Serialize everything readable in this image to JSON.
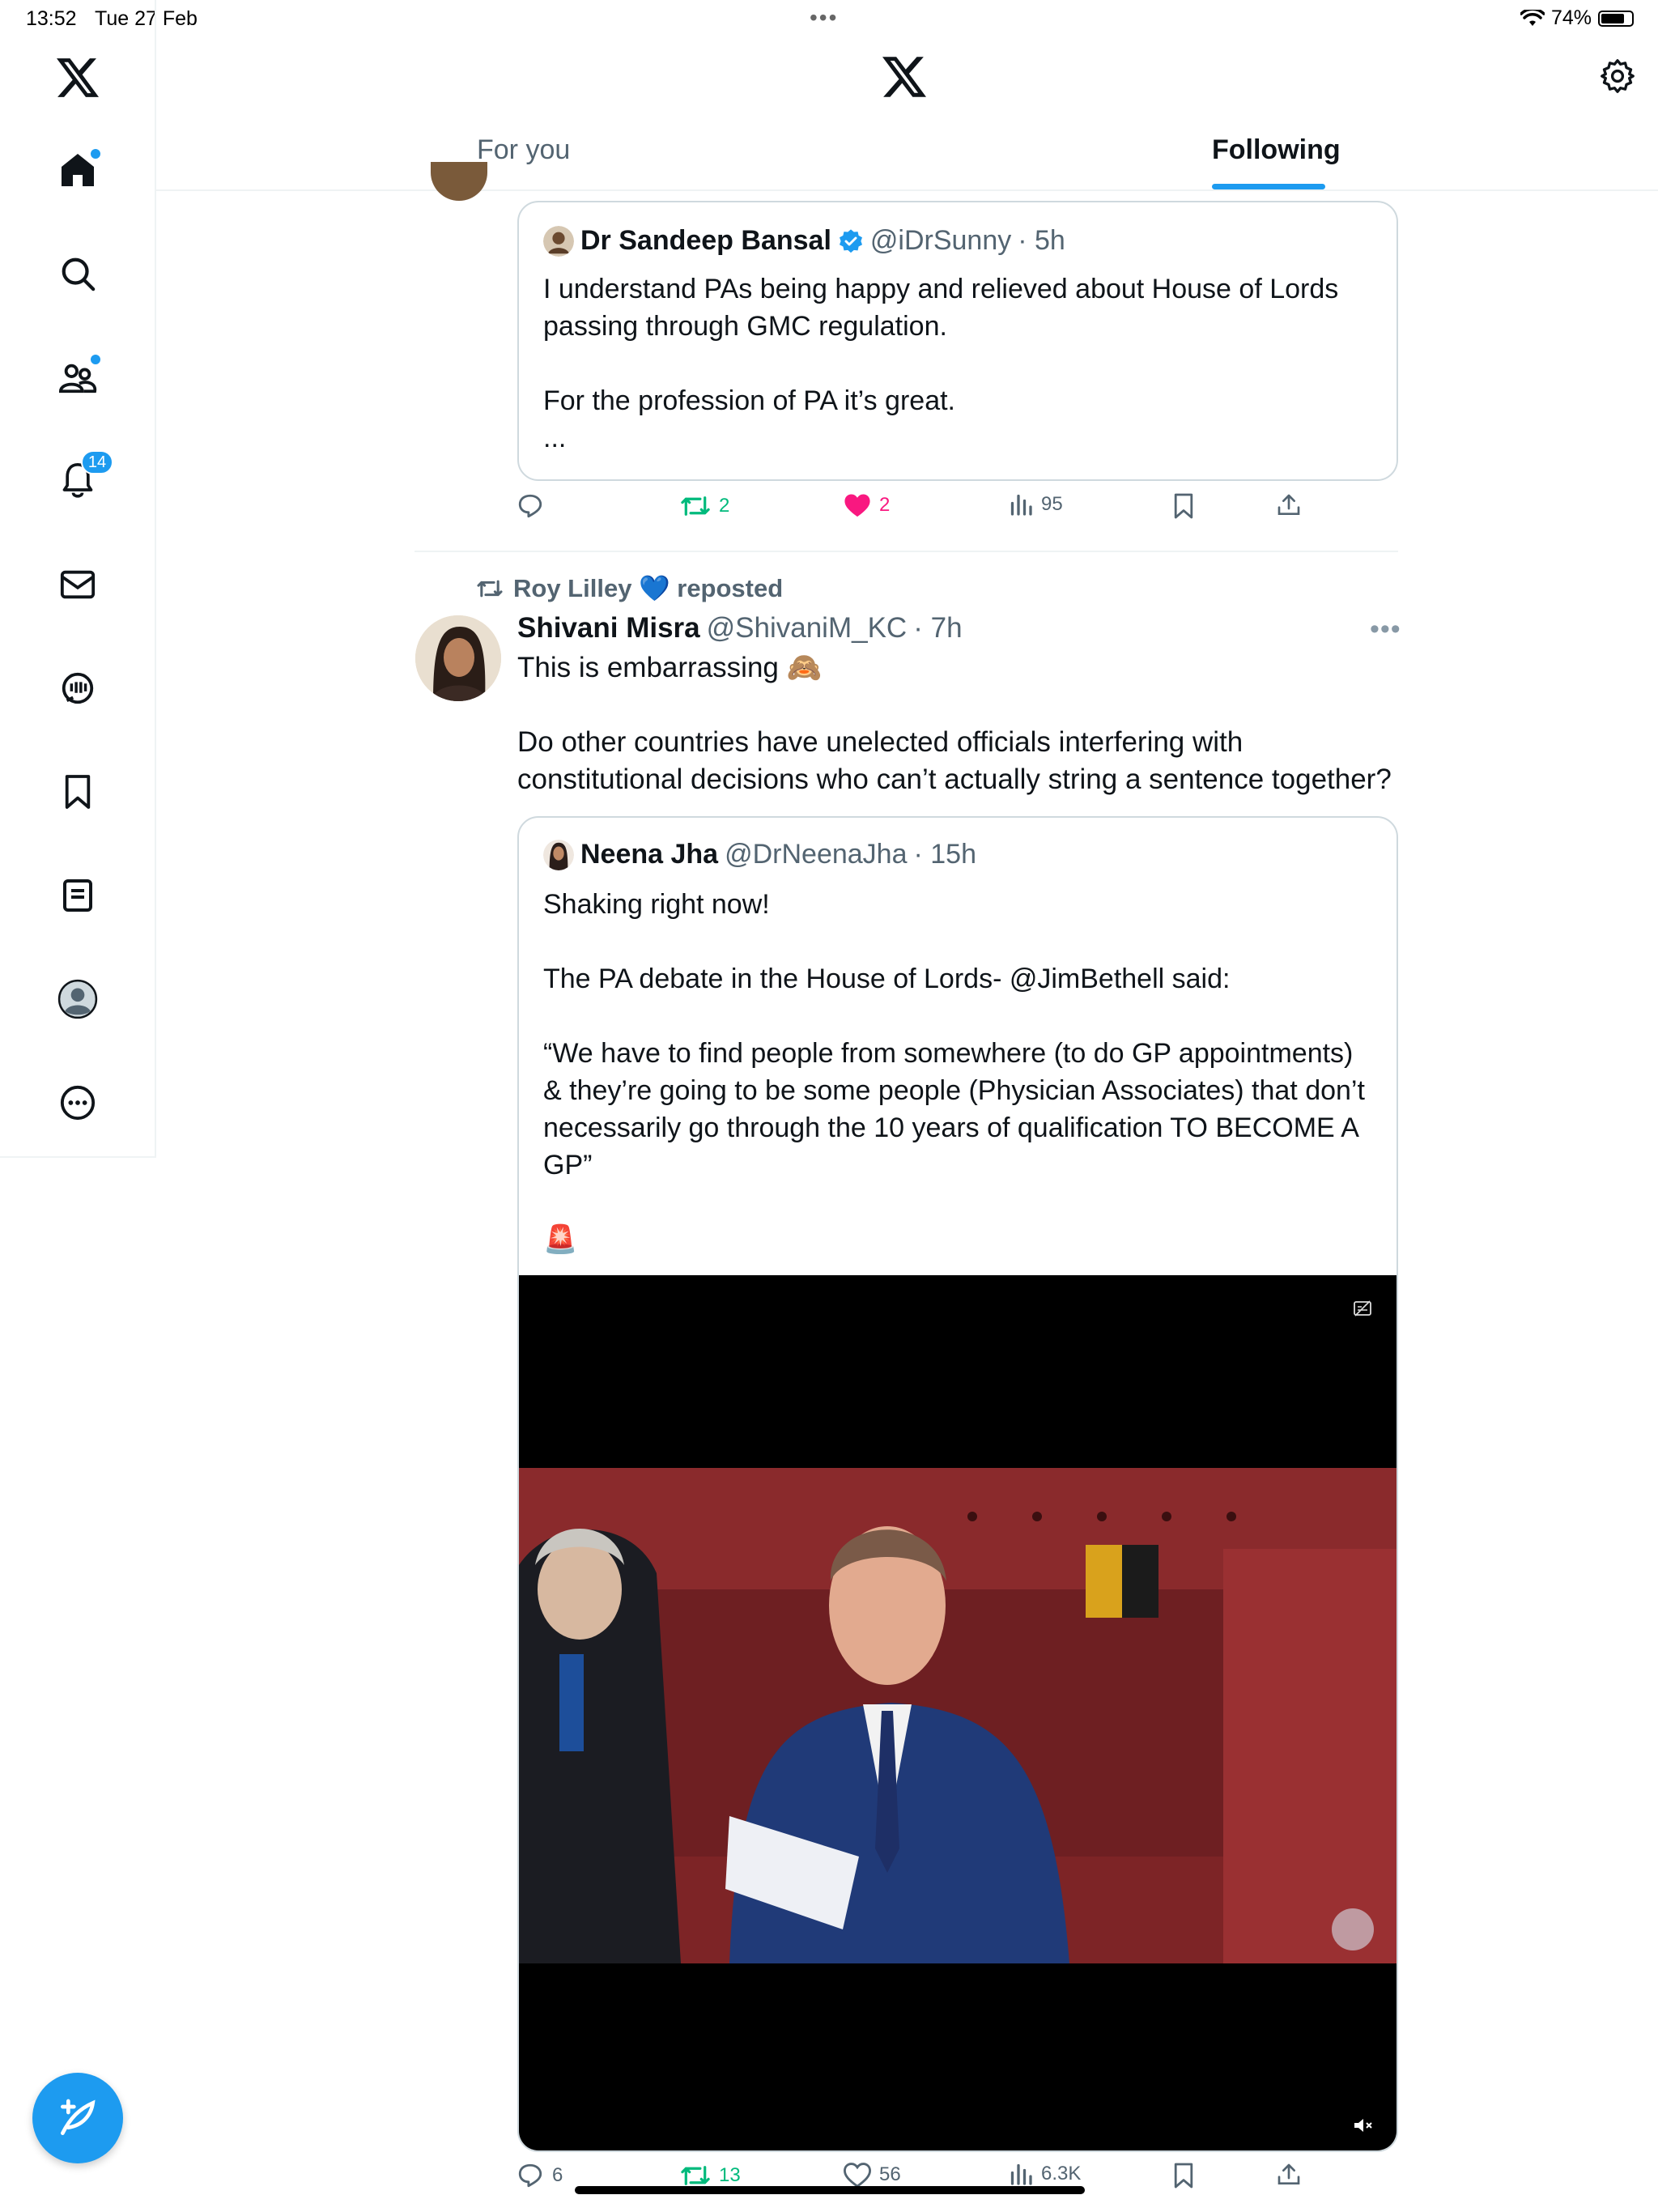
{
  "status_bar": {
    "time": "13:52",
    "date": "Tue 27 Feb",
    "battery": "74%"
  },
  "sidebar": {
    "items": [
      {
        "name": "home",
        "active": true,
        "has_dot": true
      },
      {
        "name": "explore"
      },
      {
        "name": "communities",
        "has_dot": true
      },
      {
        "name": "notifications",
        "badge": "14"
      },
      {
        "name": "messages"
      },
      {
        "name": "grok"
      },
      {
        "name": "bookmarks"
      },
      {
        "name": "lists"
      },
      {
        "name": "profile"
      },
      {
        "name": "more"
      }
    ]
  },
  "header": {
    "tabs": [
      {
        "label": "For you",
        "active": false
      },
      {
        "label": "Following",
        "active": true
      }
    ]
  },
  "feed": {
    "first_tweet": {
      "quote": {
        "name": "Dr Sandeep Bansal",
        "verified": true,
        "handle": "@iDrSunny",
        "time": "· 5h",
        "text": "I understand PAs being happy and relieved about House of Lords passing through GMC regulation.\n\nFor the profession of PA it’s great.\n..."
      },
      "actions": {
        "replies": "",
        "reposts": "2",
        "likes": "2",
        "views": "95"
      }
    },
    "second_tweet": {
      "repost_by": "Roy Lilley 💙 reposted",
      "name": "Shivani Misra",
      "handle": "@ShivaniM_KC",
      "time": "· 7h",
      "text": "This is embarrassing 🙈\n\nDo other countries have unelected officials interfering with constitutional decisions who can’t actually string a sentence together?",
      "quote": {
        "name": "Neena Jha",
        "handle": "@DrNeenaJha",
        "time": "· 15h",
        "text": "Shaking right now!\n\nThe PA debate in the House of Lords- @JimBethell said:\n\n“We have to find people from somewhere (to do GP appointments) & they’re going to be some people (Physician Associates) that don’t necessarily go through the 10 years of qualification TO BECOME A GP”\n\n🚨"
      },
      "actions": {
        "replies": "6",
        "reposts": "13",
        "likes": "56",
        "views": "6.3K"
      }
    }
  },
  "colors": {
    "accent": "#1d9bf0",
    "like": "#f91880",
    "repost": "#00ba7c",
    "muted": "#536471"
  }
}
